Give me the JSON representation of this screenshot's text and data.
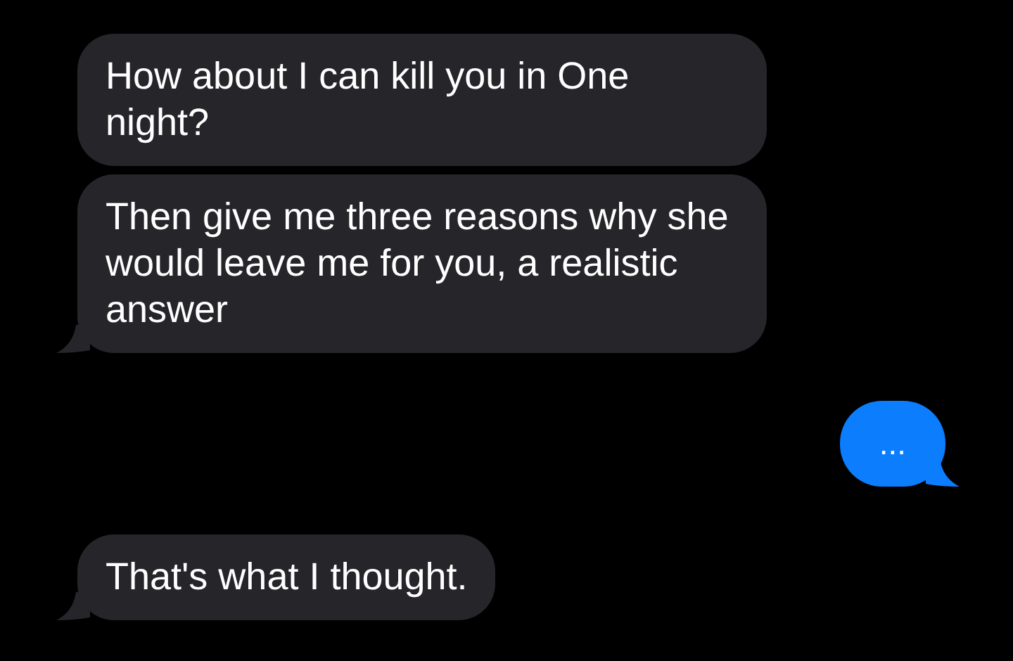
{
  "messages": [
    {
      "kind": "incoming",
      "text": "How about I can kill you in One night?",
      "tail": false
    },
    {
      "kind": "incoming",
      "text": "Then give me three reasons why she would leave me for you, a realistic answer",
      "tail": true
    },
    {
      "kind": "outgoing",
      "text": "...",
      "tail": true
    },
    {
      "kind": "incoming",
      "text": "That's what I thought.",
      "tail": true
    }
  ]
}
